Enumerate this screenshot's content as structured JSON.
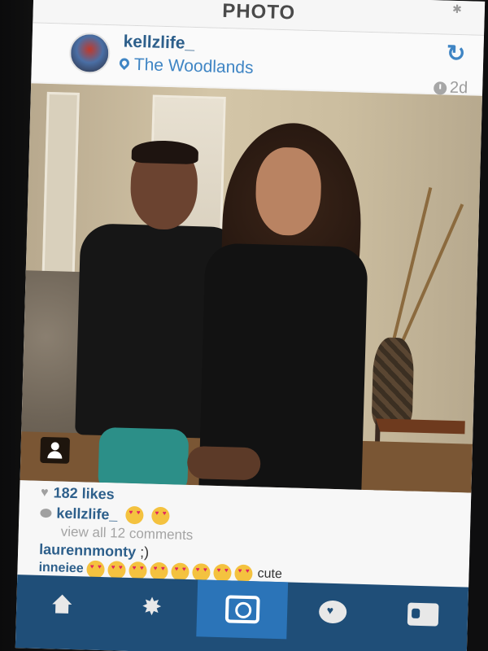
{
  "nav": {
    "title": "PHOTO"
  },
  "post": {
    "username": "kellzlife_",
    "location": "The Woodlands",
    "time": "2d"
  },
  "engagement": {
    "likes": "182 likes",
    "caption_user": "kellzlife_",
    "view_all": "view all 12 comments",
    "comment1_user": "laurennmonty",
    "comment1_text": ";)",
    "comment2_user": "inneiee",
    "comment2_text": "cute"
  },
  "icons": {
    "refresh": "refresh-icon",
    "location": "pin-icon",
    "time": "clock-icon",
    "like": "heart-icon",
    "comment": "comment-bubble-icon",
    "tag": "person-tag-icon",
    "tabs": [
      "home-icon",
      "explore-icon",
      "camera-icon",
      "activity-icon",
      "profile-icon"
    ]
  },
  "colors": {
    "link_blue": "#2d5f8b",
    "accent_blue": "#3f85c4",
    "tab_bar": "#1f4e78",
    "tab_active": "#2b74b8"
  }
}
